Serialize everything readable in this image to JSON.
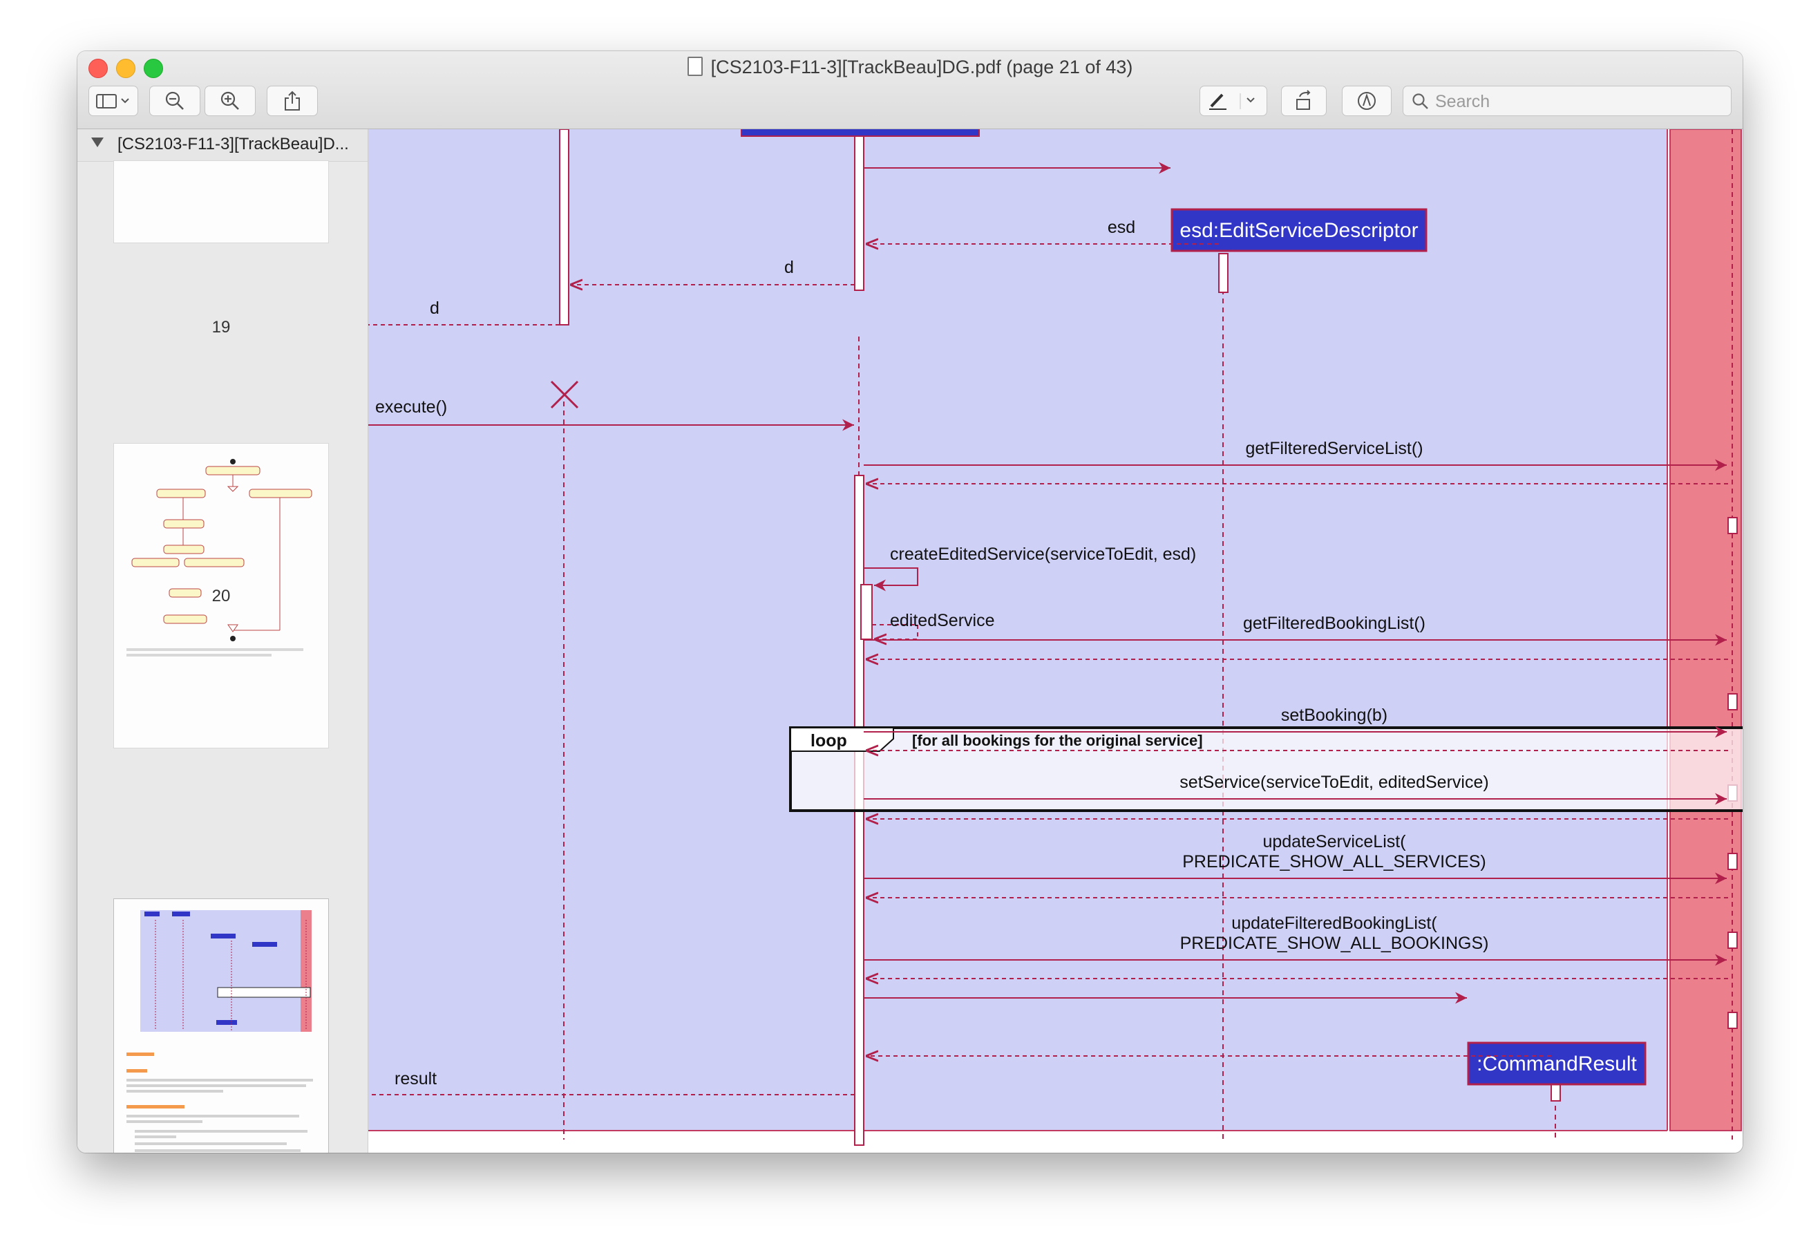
{
  "window": {
    "title": "[CS2103-F11-3][TrackBeau]DG.pdf (page 21 of 43)"
  },
  "toolbar": {
    "search_placeholder": "Search",
    "icons": [
      "sidebar-toggle-icon",
      "zoom-out-icon",
      "zoom-in-icon",
      "share-icon",
      "highlight-pen-icon",
      "rotate-icon",
      "markup-icon"
    ]
  },
  "sidebar": {
    "header_title": "[CS2103-F11-3][TrackBeau]D...",
    "pages": [
      "19",
      "20"
    ]
  },
  "diagram": {
    "participants": {
      "esd": "esd:EditServiceDescriptor",
      "command_result": ":CommandResult"
    },
    "messages": {
      "esd_return": "esd",
      "d_return_1": "d",
      "d_return_2": "d",
      "execute": "execute()",
      "get_filtered_service_list": "getFilteredServiceList()",
      "create_edited_service": "createEditedService(serviceToEdit, esd)",
      "edited_service": "editedService",
      "get_filtered_booking_list": "getFilteredBookingList()",
      "set_booking": "setBooking(b)",
      "set_service": "setService(serviceToEdit, editedService)",
      "update_service_list_1": "updateServiceList(",
      "update_service_list_2": "PREDICATE_SHOW_ALL_SERVICES)",
      "update_filtered_booking_list_1": "updateFilteredBookingList(",
      "update_filtered_booking_list_2": "PREDICATE_SHOW_ALL_BOOKINGS)",
      "result": "result"
    },
    "loop_frame": {
      "label": "loop",
      "guard": "[for all bookings for the original service]"
    },
    "colors": {
      "logic_background": "#cfd0f6",
      "model_background": "#eb7f8c",
      "participant_box": "#3236c6",
      "arrow": "#b0204a"
    }
  }
}
